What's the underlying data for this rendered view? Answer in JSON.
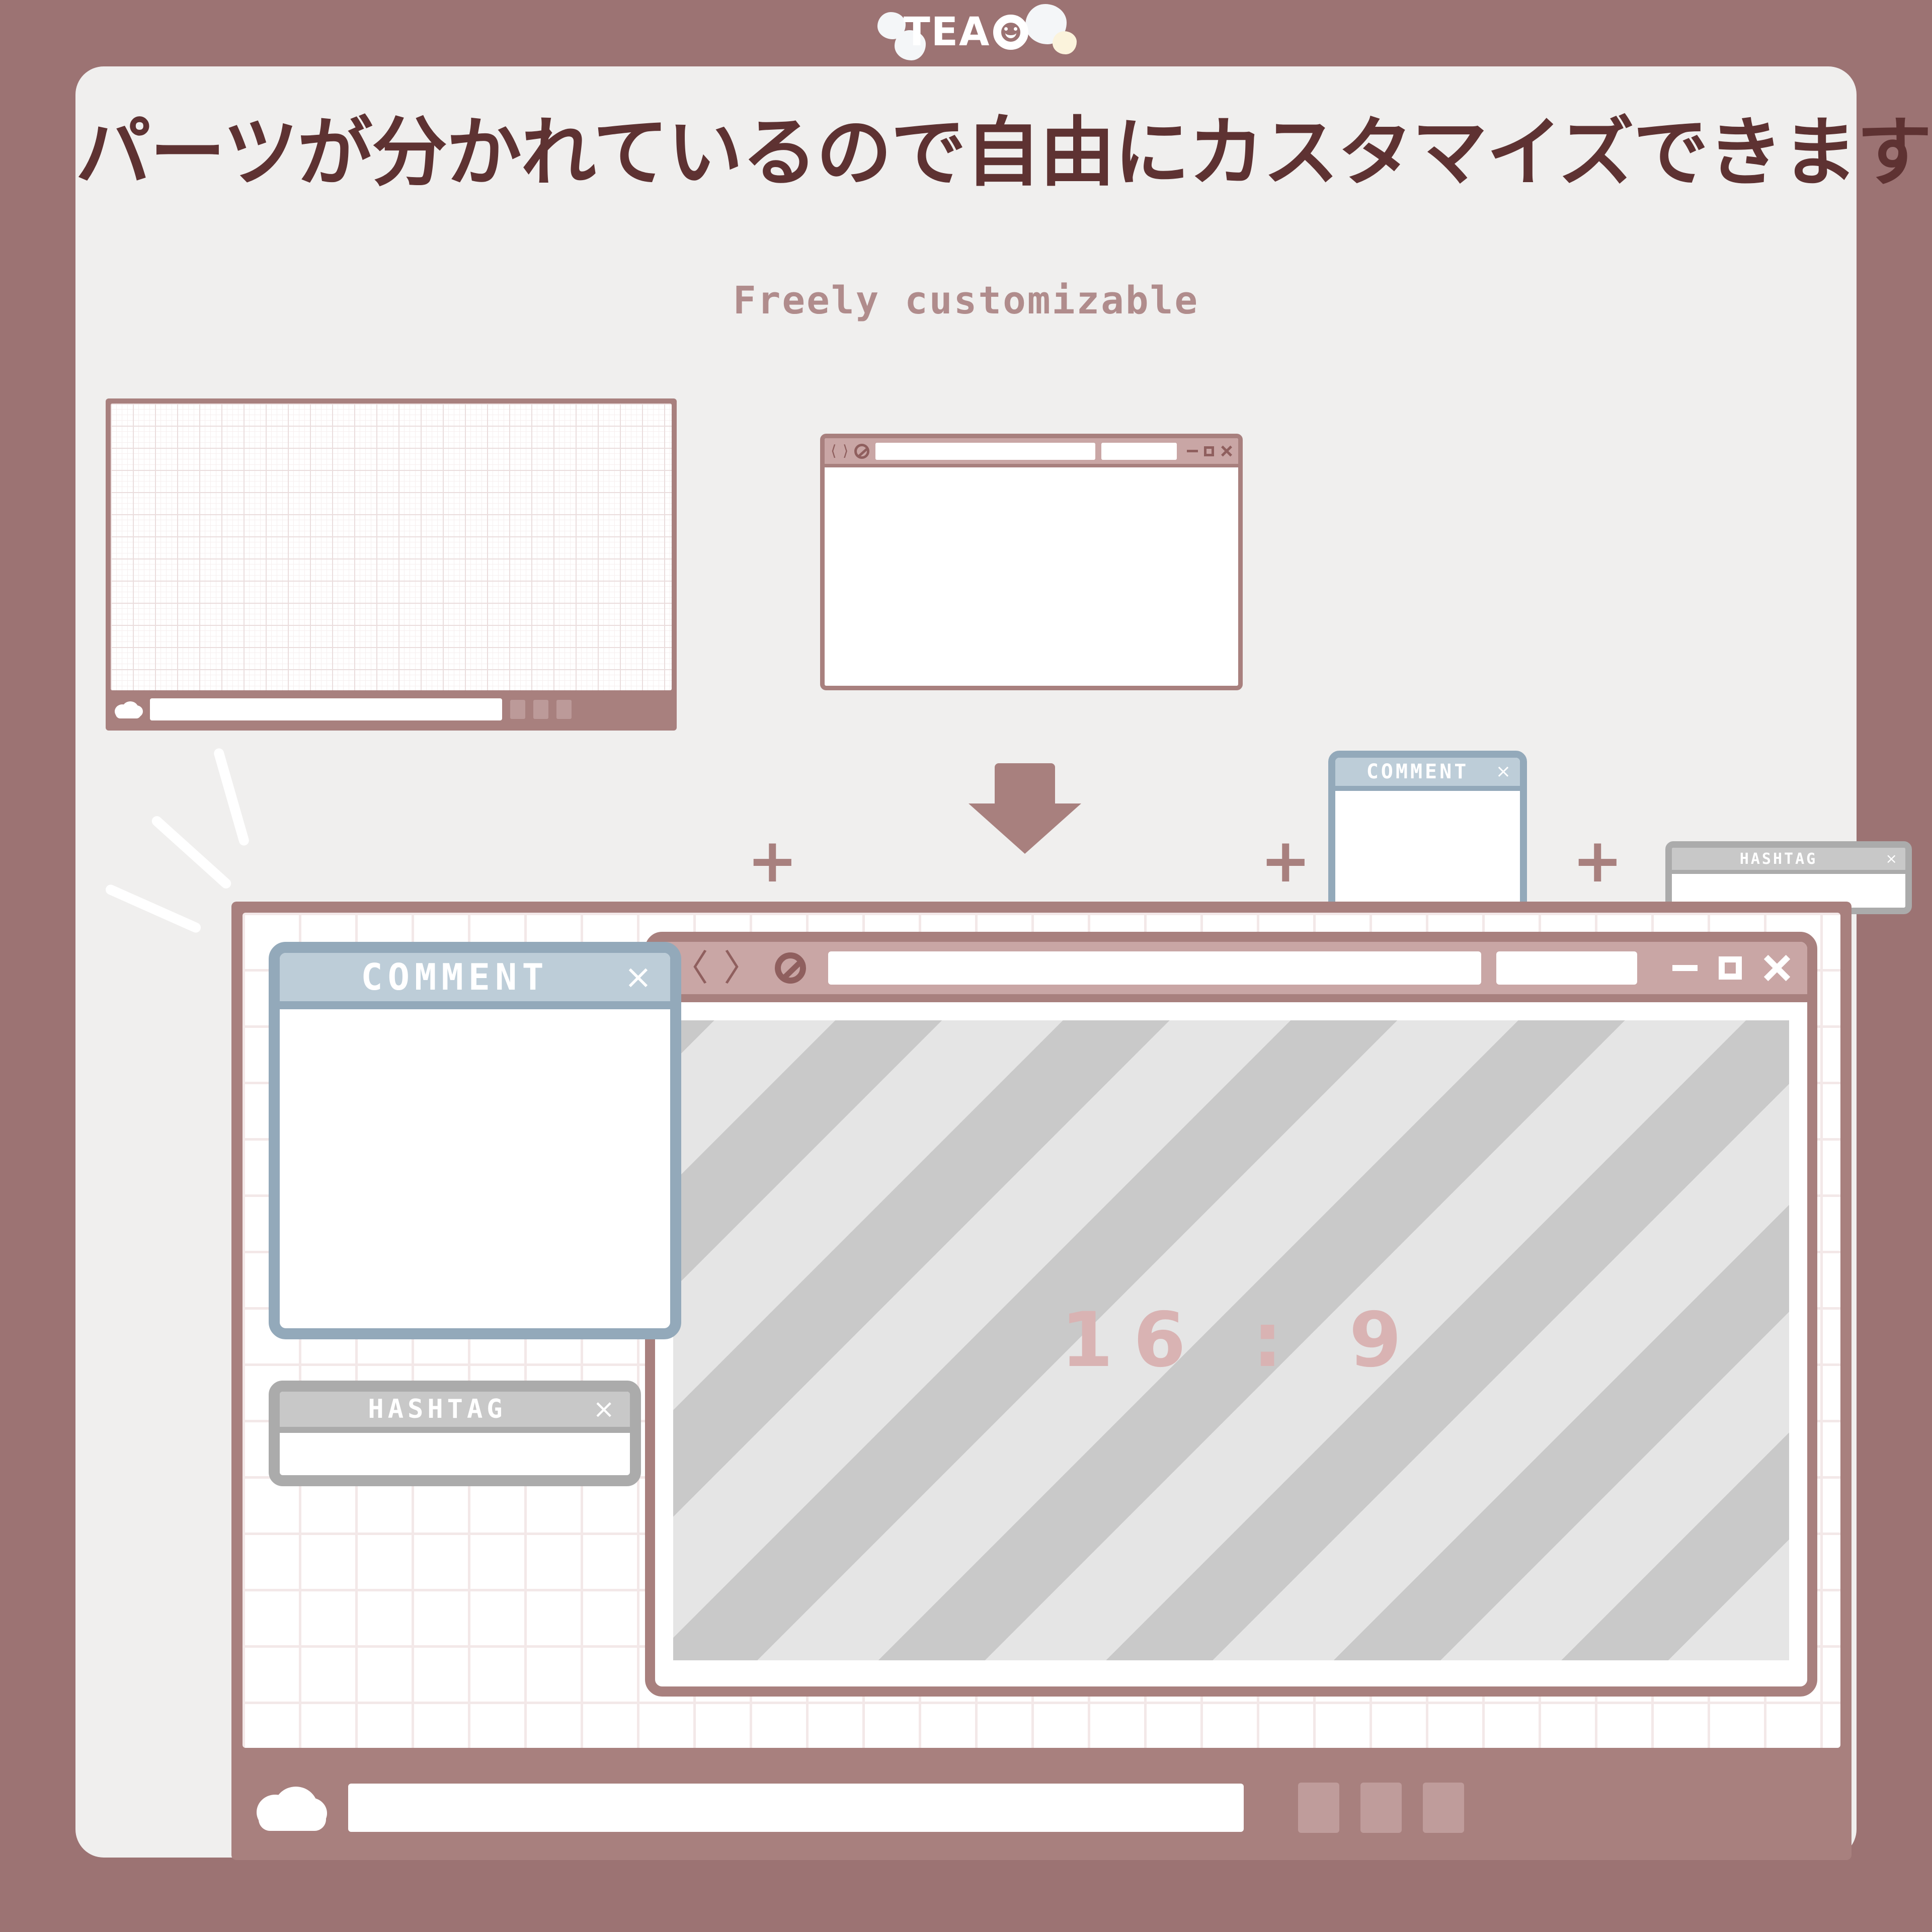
{
  "brand": {
    "name": "TEA",
    "smiley_icon": "smiley-face-icon"
  },
  "heading": {
    "title": "パーツが分かれているので自由にカスタマイズできます",
    "subtitle": "Freely  customizable"
  },
  "parts": {
    "separator": "+",
    "grid_panel": {
      "name": "grid-background-panel",
      "cloud_icon": "cloud-icon",
      "url_field_value": "",
      "square_buttons": [
        "",
        "",
        ""
      ]
    },
    "browser_window": {
      "name": "browser-window-part",
      "back_icon": "chevron-left-icon",
      "forward_icon": "chevron-right-icon",
      "refresh_icon": "refresh-circle-icon",
      "url_field_value": "",
      "search_field_value": "",
      "minimize_icon": "minimize-icon",
      "maximize_icon": "maximize-icon",
      "close_icon": "close-icon"
    },
    "comment_panel": {
      "title": "COMMENT",
      "close_label": "×",
      "body_value": ""
    },
    "hashtag_panel": {
      "title": "HASHTAG",
      "close_label": "×",
      "body_value": ""
    }
  },
  "arrow": {
    "direction": "down",
    "color": "#A8807E"
  },
  "result": {
    "name": "composed-result-frame",
    "comment_panel": {
      "title": "COMMENT",
      "close_label": "×",
      "body_value": ""
    },
    "hashtag_panel": {
      "title": "HASHTAG",
      "close_label": "×",
      "body_value": ""
    },
    "browser": {
      "back_icon": "chevron-left-icon",
      "forward_icon": "chevron-right-icon",
      "back_label": "〈",
      "forward_label": "〉",
      "refresh_icon": "refresh-circle-icon",
      "url_field_value": "",
      "search_field_value": "",
      "minimize_icon": "minimize-icon",
      "maximize_icon": "maximize-icon",
      "close_icon": "close-icon",
      "placeholder_ratio": "16 : 9"
    },
    "bottom_bar": {
      "cloud_icon": "cloud-icon",
      "url_field_value": "",
      "square_buttons": [
        "",
        "",
        ""
      ]
    }
  },
  "colors": {
    "page_background": "#9C7373",
    "card_background": "#F0EFEE",
    "accent_rose": "#A8807E",
    "accent_rose_light": "#C9A6A5",
    "title_text": "#5E3232",
    "subtitle_text": "#B08C8C",
    "blue_border": "#93A9BA",
    "blue_header": "#BDCDD8",
    "gray_border": "#ABABAB",
    "gray_header": "#C8C8C8",
    "ratio_text": "#D9B3B3"
  }
}
